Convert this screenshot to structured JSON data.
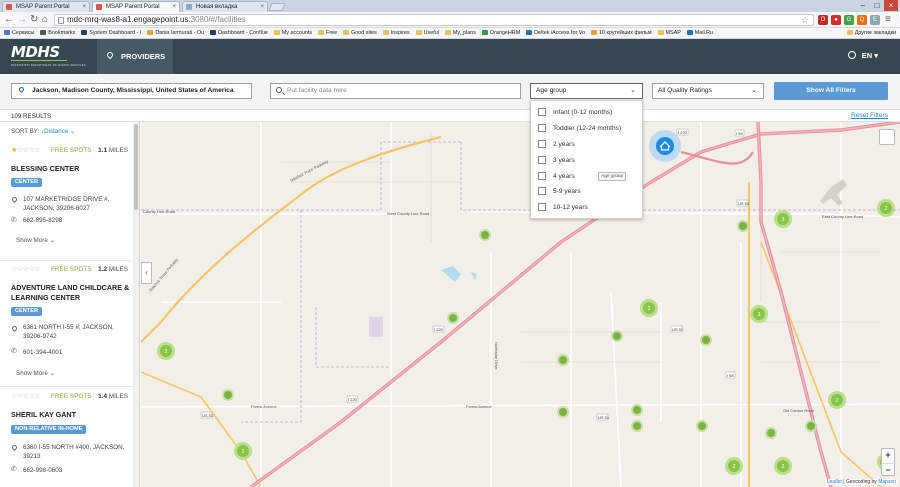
{
  "browser": {
    "tabs": [
      {
        "title": "MSAP Parent Portal"
      },
      {
        "title": "MSAP Parent Portal"
      },
      {
        "title": "Новая вкладка"
      }
    ],
    "url_host": "mdc-mrq-was8-a1.engagepoint.us",
    "url_path": ":3080/#/facilities",
    "bookmarks": [
      "Сервисы",
      "Bookmarks",
      "System Dashboard - I",
      "Dania Iarmurati - Ou",
      "Dashboard - Conflue",
      "My accounts",
      "Free",
      "Good sites",
      "Inspires",
      "Useful",
      "My_plans",
      "OrangeHRM",
      "Deltek iAccess for Vo",
      "10 крутейших фильм",
      "MSAP",
      "Mail.Ru"
    ],
    "other_bookmarks": "Другие закладки"
  },
  "app": {
    "logo": "MDHS",
    "logo_sub": "MISSISSIPPI DEPARTMENT OF HUMAN SERVICES",
    "nav_providers": "PROVIDERS",
    "language": "EN"
  },
  "filters": {
    "location": "Jackson, Madison County, Mississippi, United States of America",
    "search_placeholder": "Put facility data here",
    "age_group": "Age group",
    "quality": "All Quality Ratings",
    "show_all": "Show All Filters",
    "reset": "Reset Filters"
  },
  "age_options": [
    "Infant (0-12 months)",
    "Toddler (12-24 months)",
    "2 years",
    "3 years",
    "4 years",
    "5-9 years",
    "10-12 years"
  ],
  "tooltip": "Age group",
  "results": {
    "count": "109 RESULTS",
    "sort_label": "SORT BY:",
    "sort_value": "Distance"
  },
  "providers": [
    {
      "stars": 1,
      "spots": "FREE SPOTS",
      "miles": "1.1",
      "miles_unit": "MILES",
      "name": "BLESSING CENTER",
      "type": "CENTER",
      "address": "107 MARKETRIDGE DRIVE #, JACKSON, 39206-6027",
      "phone": "662-895-8298",
      "more": "Show More"
    },
    {
      "stars": 0,
      "spots": "FREE SPOTS",
      "miles": "1.2",
      "miles_unit": "MILES",
      "name": "ADVENTURE LAND CHILDCARE & LEARNING CENTER",
      "type": "CENTER",
      "address": "6361 NORTH I-55 #, JACKSON, 39206-9742",
      "phone": "601-394-4001",
      "more": "Show More"
    },
    {
      "stars": 0,
      "spots": "FREE SPOTS",
      "miles": "1.4",
      "miles_unit": "MILES",
      "name": "SHERIL KAY GANT",
      "type": "NON-RELATIVE IN-HOME",
      "address": "6360 I-55 NORTH #400, JACKSON, 39213",
      "phone": "662-998-0603"
    }
  ],
  "map": {
    "road_labels": [
      "County Line Road",
      "West County Line Road",
      "East County Line Road",
      "Forest Avenue",
      "Old Canton Road",
      "Northside Drive",
      "Natchez Trace Parkway",
      "I 55",
      "I 220",
      "US 51"
    ],
    "cluster_labels": [
      "2",
      "3",
      "2",
      "2",
      "2",
      "3",
      "2",
      "2",
      "2",
      "2"
    ],
    "attribution_leaflet": "Leaflet",
    "attribution_text": "| Geocoding by",
    "attribution_provider": "Mapzen",
    "zoom_in": "+",
    "zoom_out": "−",
    "collapse": "‹"
  }
}
